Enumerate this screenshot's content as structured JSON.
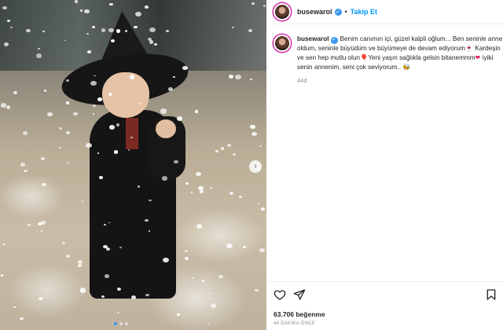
{
  "post": {
    "username": "busewarol",
    "follow_label": "Takip Et",
    "separator": "•",
    "caption": {
      "text_1": "Benim canımın içi, güzel kalpli oğlum... Ben seninle anne oldum, seninle büyüdüm ve büyümeye de devam ediyorum",
      "emoji_1": "🍷",
      "text_2": " Kardeşin ve sen hep mutlu olun",
      "emoji_2": "🎈",
      "text_3": "Yeni yaşın sağlıkla gelsin bitanemmm",
      "emoji_3": "❤",
      "text_4": " iyiki senin annenim, seni çok seviyorum..",
      "emoji_4": "🐝"
    },
    "age": "44d",
    "likes": "63.706 beğenme",
    "time": "44 DAKİKA ÖNCE"
  },
  "carousel": {
    "next_glyph": "›",
    "dot_count": 3,
    "active_dot": 0
  },
  "colors": {
    "accent": "#0095f6",
    "verified": "#3897f0",
    "text": "#262626",
    "muted": "#8e8e8e"
  },
  "icons": {
    "like": "heart-outline-icon",
    "share": "paper-plane-icon",
    "save": "bookmark-icon",
    "verified": "verified-badge-icon",
    "next": "chevron-right-icon"
  }
}
